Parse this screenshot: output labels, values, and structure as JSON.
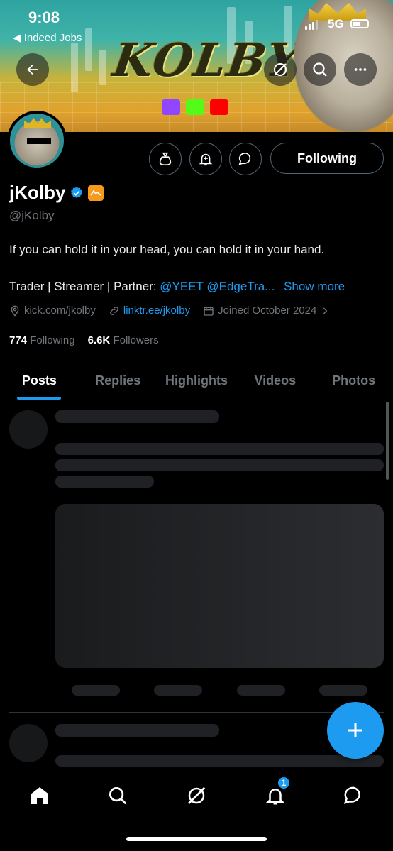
{
  "status_bar": {
    "time": "9:08",
    "back_app": "◀ Indeed Jobs",
    "network": "5G"
  },
  "banner": {
    "title": "KOLBY"
  },
  "profile": {
    "name": "jKolby",
    "handle": "@jKolby",
    "bio_line1": "If you can hold it in your head, you can hold it in your hand.",
    "bio_line2_prefix": "Trader | Streamer | Partner:",
    "bio_mentions": "@YEET @EdgeTra...",
    "show_more": "Show more",
    "location": "kick.com/jkolby",
    "website": "linktr.ee/jkolby",
    "joined": "Joined October 2024",
    "following_count": "774",
    "following_label": "Following",
    "followers_count": "6.6K",
    "followers_label": "Followers"
  },
  "actions": {
    "following_button": "Following"
  },
  "tabs": [
    {
      "label": "Posts"
    },
    {
      "label": "Replies"
    },
    {
      "label": "Highlights"
    },
    {
      "label": "Videos"
    },
    {
      "label": "Photos"
    }
  ],
  "bottom_nav": {
    "notifications_badge": "1"
  },
  "colors": {
    "accent": "#1d9bf0",
    "background": "#000000",
    "muted": "#71767b"
  },
  "icons": [
    "back-arrow-icon",
    "grok-icon",
    "search-icon",
    "more-icon",
    "money-bag-icon",
    "bell-add-icon",
    "message-icon",
    "verified-icon",
    "location-icon",
    "link-icon",
    "calendar-icon",
    "chevron-right-icon",
    "plus-icon",
    "home-icon",
    "explore-icon",
    "grok-icon",
    "bell-icon",
    "mail-icon"
  ]
}
